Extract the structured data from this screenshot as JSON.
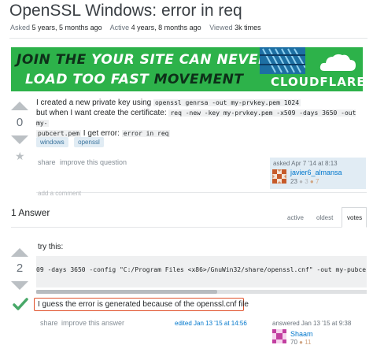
{
  "question": {
    "title": "OpenSSL Windows: error in req",
    "asked_label": "Asked",
    "asked_value": "5 years, 5 months ago",
    "active_label": "Active",
    "active_value": "4 years, 8 months ago",
    "viewed_label": "Viewed",
    "viewed_value": "3k times",
    "votes": "0",
    "body": {
      "t1": "I created a new private key using",
      "c1": "openssl genrsa -out my-prvkey.pem 1024",
      "t2": "but when I want create the certificate:",
      "c2": "req -new -key my-prvkey.pem -x509 -days 3650 -out my-",
      "c3": "pubcert.pem",
      "t3": "I get error:",
      "c4": "error in req"
    },
    "tags": [
      "windows",
      "openssl"
    ],
    "share": "share",
    "improve": "improve this question",
    "asked_on": "asked Apr 7 '14 at 8:13",
    "user": {
      "name": "javier6_almansa",
      "rep": "23",
      "silver": "● 3",
      "bronze": "● 7"
    },
    "add_comment": "add a comment"
  },
  "banner": {
    "line1_dark": "JOIN THE",
    "line1_white": "YOUR SITE CAN NEVER",
    "line2_white": "LOAD TOO FAST",
    "line2_dark": "MOVEMENT",
    "brand": "CLOUDFLARE"
  },
  "answers": {
    "count_label": "1 Answer",
    "tabs": [
      "active",
      "oldest",
      "votes"
    ],
    "answer": {
      "votes": "2",
      "intro": "try this:",
      "code": "09 -days 3650 -config \"C:/Program Files <x86>/GnuWin32/share/openssl.cnf\" -out my-pubcert.pem",
      "note": "I guess the error is generated because of the openssl.cnf file",
      "share": "share",
      "improve": "improve this answer",
      "edited": "edited Jan 13 '15 at 14:56",
      "answered": "answered Jan 13 '15 at 9:38",
      "user": {
        "name": "Shaam",
        "rep": "70",
        "bronze": "● 11"
      }
    }
  },
  "colors": {
    "accent": "#0077cc",
    "accepted": "#48a868",
    "banner": "#2db24a",
    "highlight": "#e0512b"
  }
}
